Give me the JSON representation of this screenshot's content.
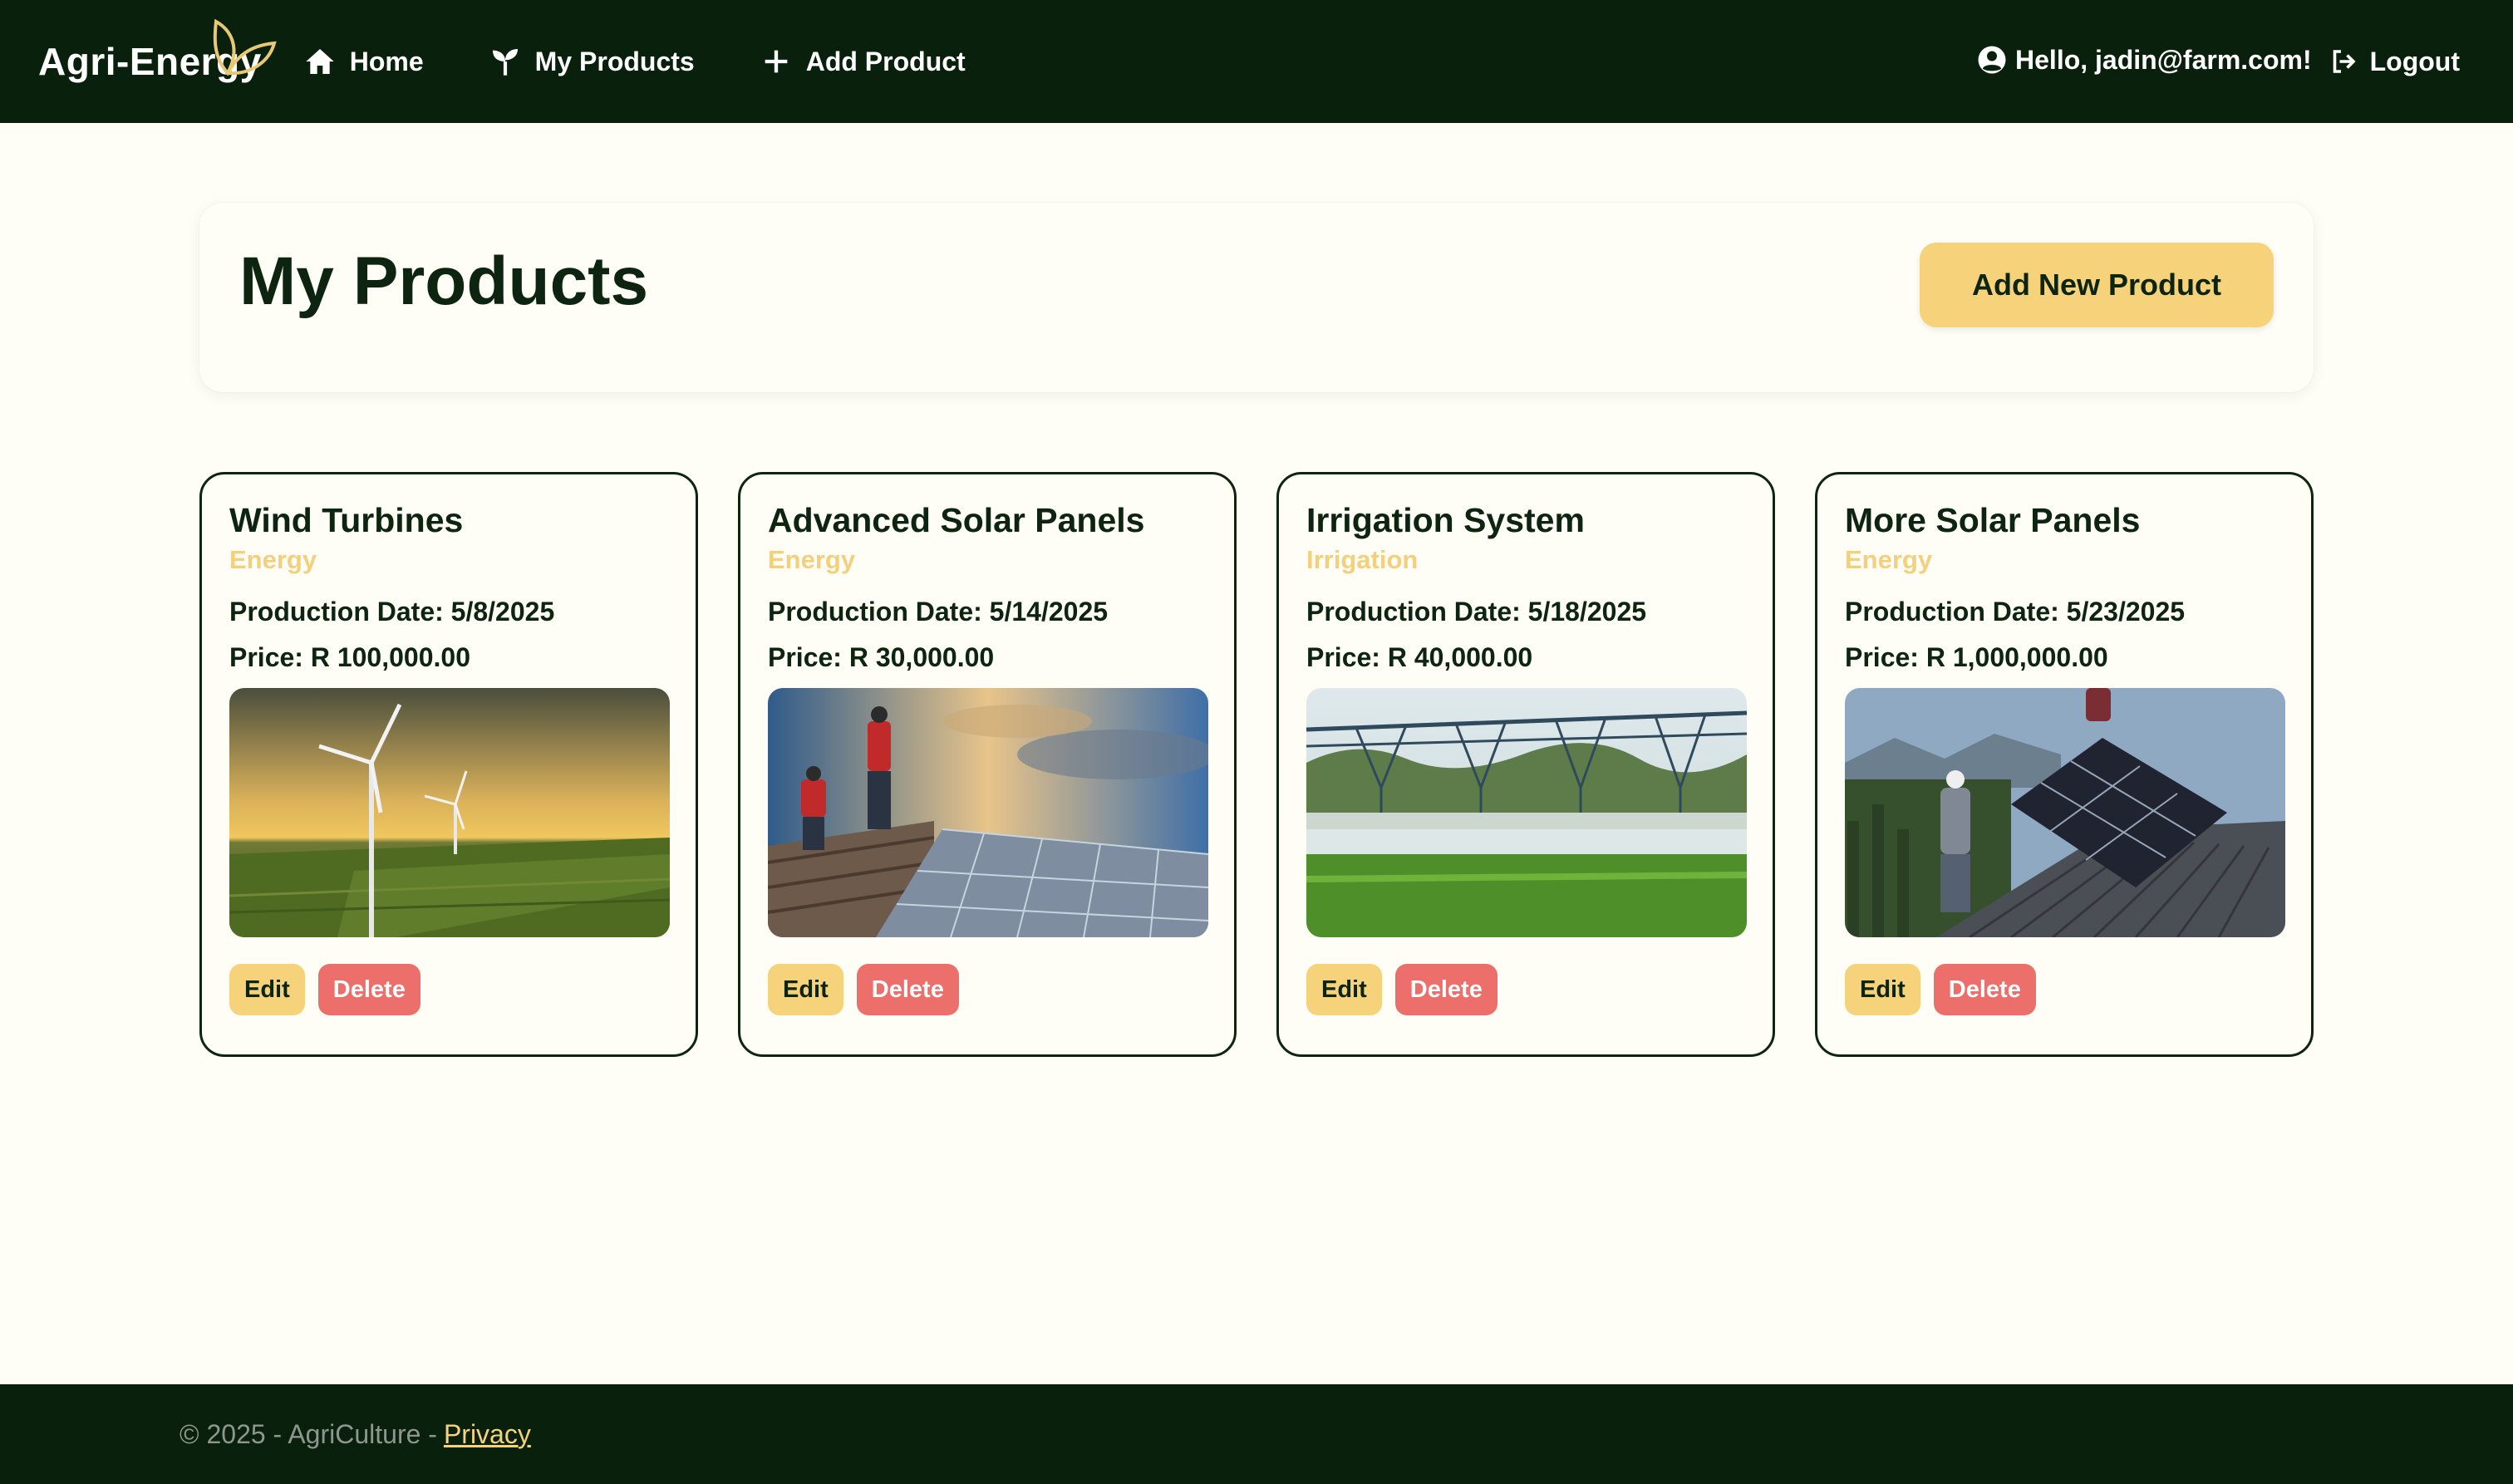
{
  "nav": {
    "brand": "Agri-Energy",
    "home": "Home",
    "my_products": "My Products",
    "add_product": "Add Product",
    "greeting": "Hello, jadin@farm.com!",
    "logout": "Logout"
  },
  "header": {
    "title": "My Products",
    "add_button": "Add New Product"
  },
  "products": [
    {
      "name": "Wind Turbines",
      "category": "Energy",
      "production_date": "Production Date: 5/8/2025",
      "price": "Price: R 100,000.00",
      "image": "wind-turbines-photo"
    },
    {
      "name": "Advanced Solar Panels",
      "category": "Energy",
      "production_date": "Production Date: 5/14/2025",
      "price": "Price: R 30,000.00",
      "image": "solar-installers-photo"
    },
    {
      "name": "Irrigation System",
      "category": "Irrigation",
      "production_date": "Production Date: 5/18/2025",
      "price": "Price: R 40,000.00",
      "image": "pivot-irrigation-photo"
    },
    {
      "name": "More Solar Panels",
      "category": "Energy",
      "production_date": "Production Date: 5/23/2025",
      "price": "Price: R 1,000,000.00",
      "image": "roof-solar-photo"
    }
  ],
  "actions": {
    "edit": "Edit",
    "delete": "Delete"
  },
  "footer": {
    "copyright": "© 2025 - AgriCulture -",
    "privacy": "Privacy"
  },
  "colors": {
    "nav_bg": "#09200c",
    "accent": "#f6d37a",
    "danger": "#ec6f6c",
    "page_bg": "#fefdf6",
    "text": "#0c2410"
  }
}
